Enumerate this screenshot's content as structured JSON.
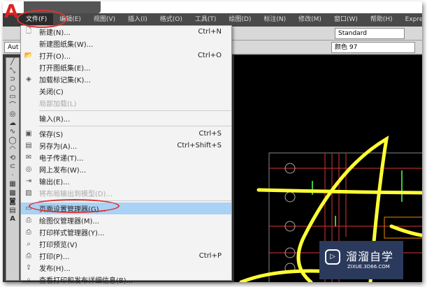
{
  "menubar": [
    "文件(F)",
    "编辑(E)",
    "视图(V)",
    "插入(I)",
    "格式(O)",
    "工具(T)",
    "绘图(D)",
    "标注(N)",
    "修改(M)",
    "窗口(W)",
    "帮助(H)",
    "Express"
  ],
  "toolbar": {
    "text_style": "Standard",
    "workspace": "Aut",
    "color": "颜色 97"
  },
  "file_menu": [
    {
      "label": "新建(N)...",
      "shortcut": "Ctrl+N",
      "icon": "new-file-icon"
    },
    {
      "label": "新建图纸集(W)...",
      "shortcut": "",
      "icon": ""
    },
    {
      "label": "打开(O)...",
      "shortcut": "Ctrl+O",
      "icon": "open-folder-icon"
    },
    {
      "label": "打开图纸集(E)...",
      "shortcut": "",
      "icon": ""
    },
    {
      "label": "加载标记集(K)...",
      "shortcut": "",
      "icon": "markup-icon"
    },
    {
      "label": "关闭(C)",
      "shortcut": "",
      "icon": ""
    },
    {
      "label": "局部加载(L)",
      "shortcut": "",
      "icon": "",
      "disabled": true
    },
    {
      "sep": true
    },
    {
      "label": "输入(R)...",
      "shortcut": "",
      "icon": ""
    },
    {
      "sep": true
    },
    {
      "label": "保存(S)",
      "shortcut": "Ctrl+S",
      "icon": "save-icon"
    },
    {
      "label": "另存为(A)...",
      "shortcut": "Ctrl+Shift+S",
      "icon": "save-as-icon"
    },
    {
      "label": "电子传递(T)...",
      "shortcut": "",
      "icon": "etransmit-icon"
    },
    {
      "label": "网上发布(W)...",
      "shortcut": "",
      "icon": "publish-web-icon"
    },
    {
      "label": "输出(E)...",
      "shortcut": "",
      "icon": "export-icon"
    },
    {
      "label": "将布局输出到模型(D)...",
      "shortcut": "",
      "icon": "layout-icon",
      "disabled": true
    },
    {
      "sep": true
    },
    {
      "label": "页面设置管理器(G)...",
      "shortcut": "",
      "icon": "page-setup-icon",
      "highlighted": true
    },
    {
      "label": "绘图仪管理器(M)...",
      "shortcut": "",
      "icon": "plotter-icon"
    },
    {
      "label": "打印样式管理器(Y)...",
      "shortcut": "",
      "icon": "plot-style-icon"
    },
    {
      "label": "打印预览(V)",
      "shortcut": "",
      "icon": "preview-icon"
    },
    {
      "label": "打印(P)...",
      "shortcut": "Ctrl+P",
      "icon": "print-icon"
    },
    {
      "label": "发布(H)...",
      "shortcut": "",
      "icon": "publish-icon"
    },
    {
      "label": "查看打印和发布详细信息(B)...",
      "shortcut": "",
      "icon": "details-icon"
    }
  ],
  "watermark": {
    "name": "溜溜自学",
    "url": "ZIXUE.3D66.COM"
  }
}
